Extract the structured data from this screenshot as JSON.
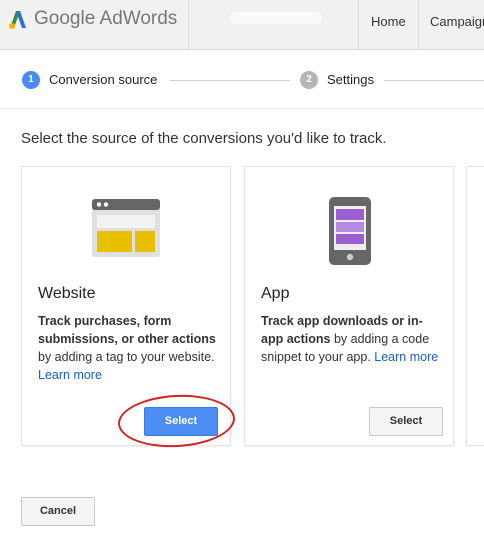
{
  "header": {
    "logo_google": "Google",
    "logo_product": "AdWords",
    "nav": [
      "Home",
      "Campaigns"
    ]
  },
  "steps": [
    {
      "number": "1",
      "label": "Conversion source",
      "active": true
    },
    {
      "number": "2",
      "label": "Settings",
      "active": false
    }
  ],
  "heading": "Select the source of the conversions you'd like to track.",
  "cards": {
    "website": {
      "title": "Website",
      "desc_bold": "Track purchases, form submissions, or other actions",
      "desc_rest": " by adding a tag to your website. ",
      "link": "Learn more",
      "button": "Select"
    },
    "app": {
      "title": "App",
      "desc_bold": "Track app downloads or in-app actions",
      "desc_rest": " by adding a code snippet to your app. ",
      "link": "Learn more",
      "button": "Select"
    }
  },
  "footer": {
    "cancel": "Cancel"
  },
  "colors": {
    "primary_button": "#4d8ef5",
    "active_step": "#4a8af4",
    "annotation": "#d32222",
    "website_icon_accent": "#e8c000",
    "app_icon_accent": "#9c5fd1"
  }
}
